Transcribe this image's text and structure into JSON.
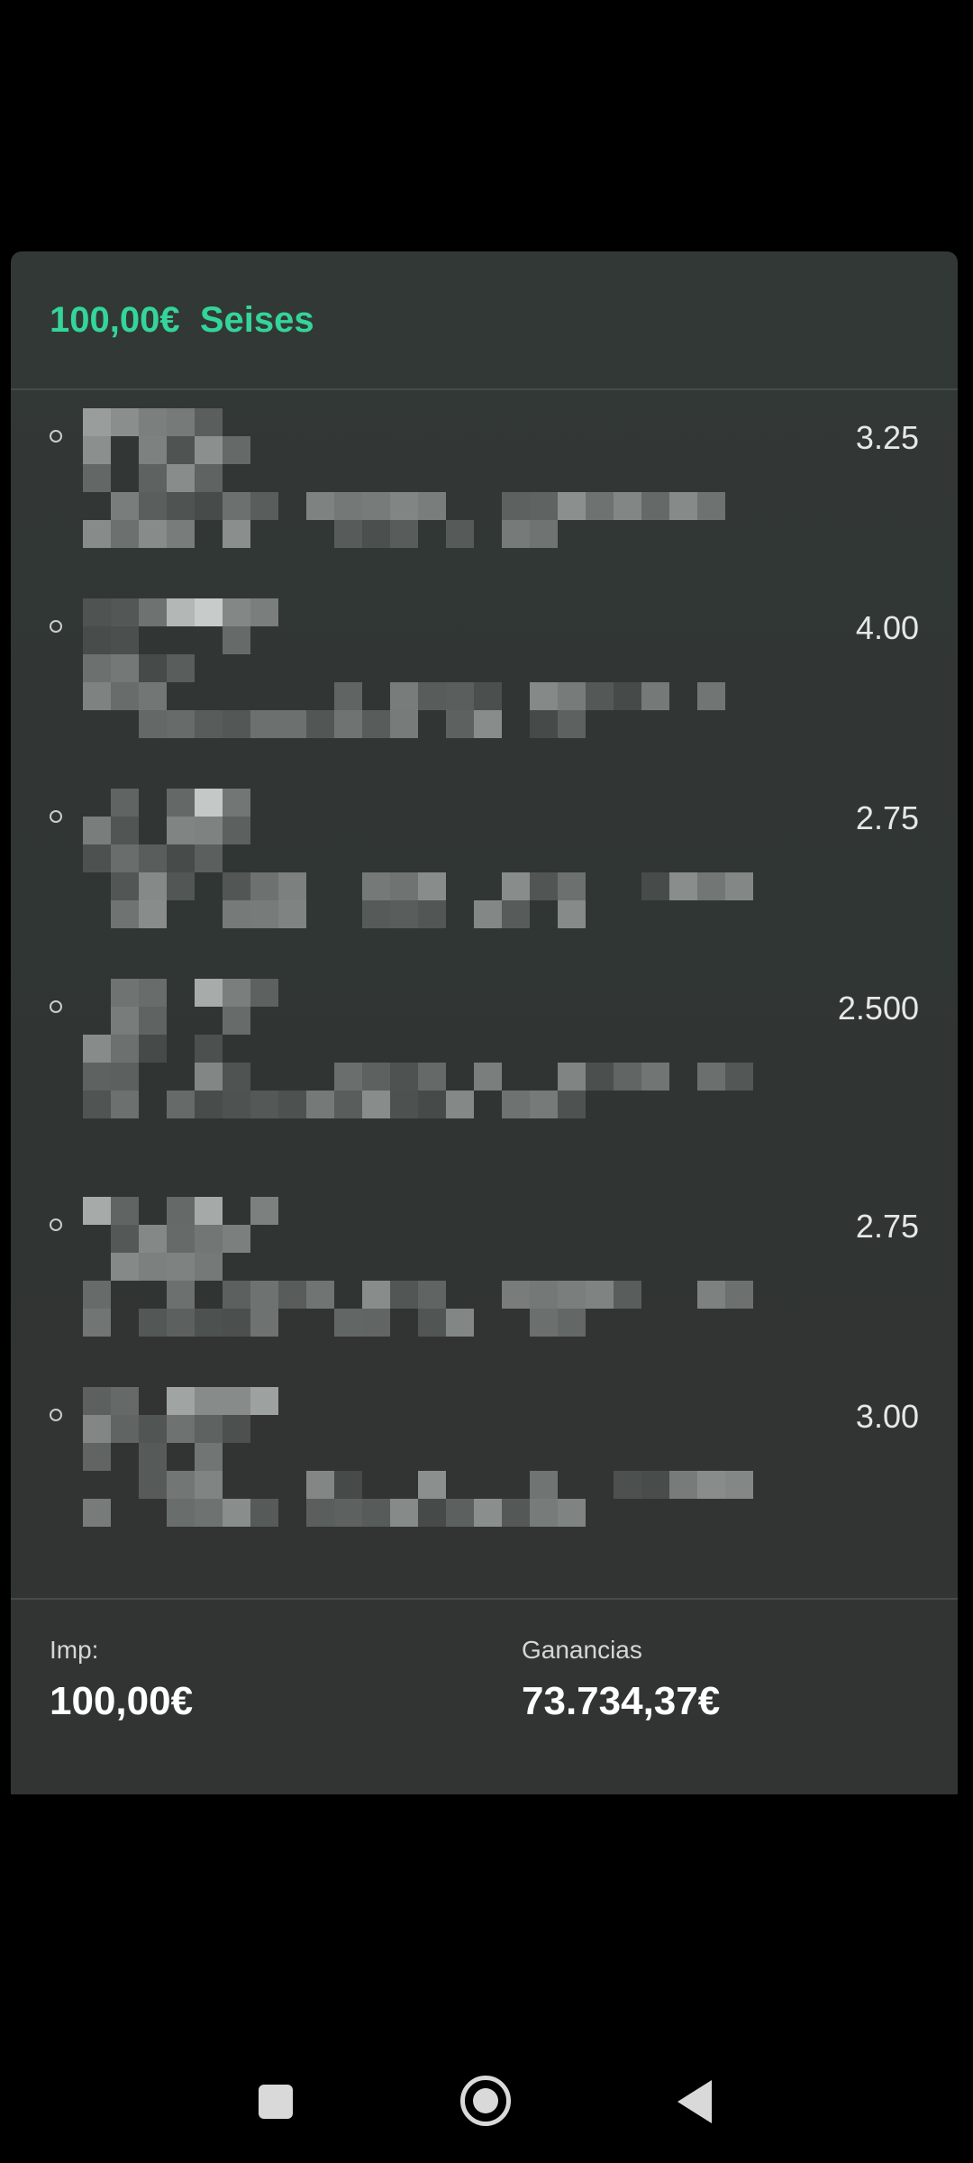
{
  "bet_header": {
    "stake": "100,00€",
    "bet_type": "Seises"
  },
  "selections": [
    {
      "odds": "3.25"
    },
    {
      "odds": "4.00"
    },
    {
      "odds": "2.75"
    },
    {
      "odds": "2.500"
    },
    {
      "odds": "2.75"
    },
    {
      "odds": "3.00"
    }
  ],
  "footer": {
    "stake_label": "Imp:",
    "stake_value": "100,00€",
    "winnings_label": "Ganancias",
    "winnings_value": "73.734,37€"
  },
  "navbar": {
    "recents_icon": "square-icon",
    "home_icon": "circle-home-icon",
    "back_icon": "triangle-back-icon"
  },
  "colors": {
    "accent": "#34d49a",
    "card_bg": "#313634",
    "page_bg": "#000000"
  }
}
